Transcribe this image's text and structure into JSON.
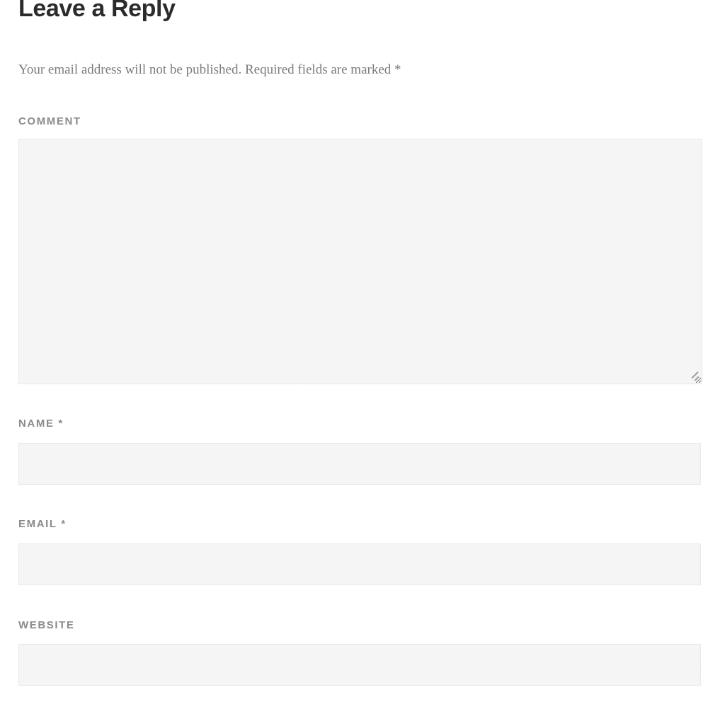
{
  "form": {
    "title": "Leave a Reply",
    "notes": "Your email address will not be published. Required fields are marked",
    "notes_required_mark": "*",
    "fields": [
      {
        "key": "comment",
        "label": "COMMENT",
        "required_mark": "",
        "type": "textarea",
        "value": "",
        "placeholder": ""
      },
      {
        "key": "name",
        "label": "NAME",
        "required_mark": "*",
        "type": "text",
        "value": "",
        "placeholder": ""
      },
      {
        "key": "email",
        "label": "EMAIL",
        "required_mark": "*",
        "type": "email",
        "value": "",
        "placeholder": ""
      },
      {
        "key": "website",
        "label": "WEBSITE",
        "required_mark": "",
        "type": "url",
        "value": "",
        "placeholder": ""
      }
    ]
  },
  "colors": {
    "page_background": "#ffffff",
    "heading_text": "#2b2b2b",
    "notes_text": "#7c7c7c",
    "label_text": "#8b8b8b",
    "field_background": "#f5f5f5",
    "field_border": "#e9e9e9",
    "resize_grip": "#9a9a9a"
  },
  "icons": {
    "resize_handle": "resize-handle-icon"
  }
}
